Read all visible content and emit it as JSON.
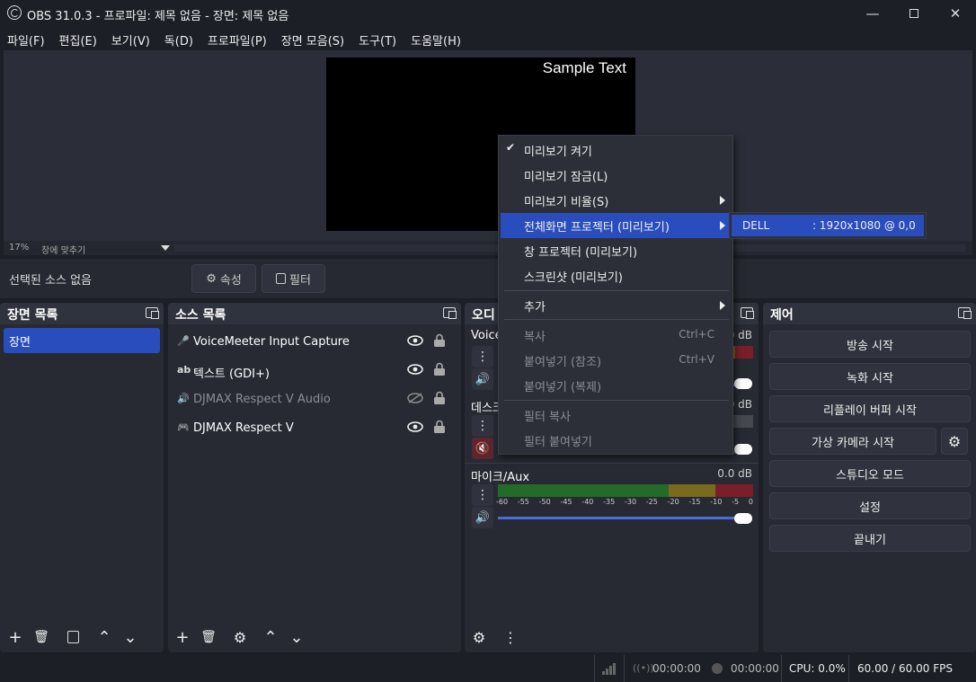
{
  "window": {
    "title": "OBS 31.0.3 - 프로파일: 제목 없음 - 장면: 제목 없음"
  },
  "menu": [
    "파일(F)",
    "편집(E)",
    "보기(V)",
    "독(D)",
    "프로파일(P)",
    "장면 모음(S)",
    "도구(T)",
    "도움말(H)"
  ],
  "preview": {
    "sample_text": "Sample Text",
    "zoom": "17%",
    "zoom_mode": "창에 맞추기"
  },
  "selection": {
    "label": "선택된 소스 없음",
    "properties": "속성",
    "filters": "필터"
  },
  "scenes": {
    "title": "장면 목록",
    "items": [
      "장면"
    ]
  },
  "sources": {
    "title": "소스 목록",
    "items": [
      {
        "name": "VoiceMeeter Input Capture",
        "icon": "microphone-icon",
        "visible": true
      },
      {
        "name": "텍스트 (GDI+)",
        "icon": "text-icon",
        "visible": true
      },
      {
        "name": "DJMAX Respect V Audio",
        "icon": "speaker-icon",
        "visible": false
      },
      {
        "name": "DJMAX Respect V",
        "icon": "gamepad-icon",
        "visible": true
      }
    ]
  },
  "audio": {
    "title": "오디",
    "channels": [
      {
        "name": "Voice",
        "db": "0 dB"
      },
      {
        "name": "데스크",
        "db": "0 dB"
      },
      {
        "name": "마이크/Aux",
        "db": "0.0 dB"
      }
    ],
    "ticks": [
      "-60",
      "-55",
      "-50",
      "-45",
      "-40",
      "-35",
      "-30",
      "-25",
      "-20",
      "-15",
      "-10",
      "-5",
      "0"
    ]
  },
  "controls": {
    "title": "제어",
    "buttons": [
      "방송 시작",
      "녹화 시작",
      "리플레이 버퍼 시작",
      "가상 카메라 시작",
      "스튜디오 모드",
      "설정",
      "끝내기"
    ]
  },
  "context_menu": {
    "items": [
      {
        "label": "미리보기 켜기",
        "checked": true
      },
      {
        "label": "미리보기 잠금(L)"
      },
      {
        "label": "미리보기 비율(S)",
        "submenu": true
      },
      {
        "label": "전체화면 프로젝터 (미리보기)",
        "submenu": true,
        "highlighted": true
      },
      {
        "label": "창 프로젝터 (미리보기)"
      },
      {
        "label": "스크린샷 (미리보기)"
      },
      {
        "label": "추가",
        "submenu": true
      },
      {
        "label": "복사",
        "shortcut": "Ctrl+C",
        "disabled": true
      },
      {
        "label": "붙여넣기 (참조)",
        "shortcut": "Ctrl+V",
        "disabled": true
      },
      {
        "label": "붙여넣기 (복제)",
        "disabled": true
      },
      {
        "label": "필터 복사",
        "disabled": true
      },
      {
        "label": "필터 붙여넣기",
        "disabled": true
      }
    ],
    "submenu": {
      "display": "DELL",
      "resolution": ": 1920x1080 @ 0,0"
    }
  },
  "status": {
    "live_time": "00:00:00",
    "rec_time": "00:00:00",
    "cpu": "CPU: 0.0%",
    "fps": "60.00 / 60.00 FPS"
  },
  "colors": {
    "accent": "#2a4dbd",
    "background": "#1c1f26",
    "panel": "#272a33"
  }
}
